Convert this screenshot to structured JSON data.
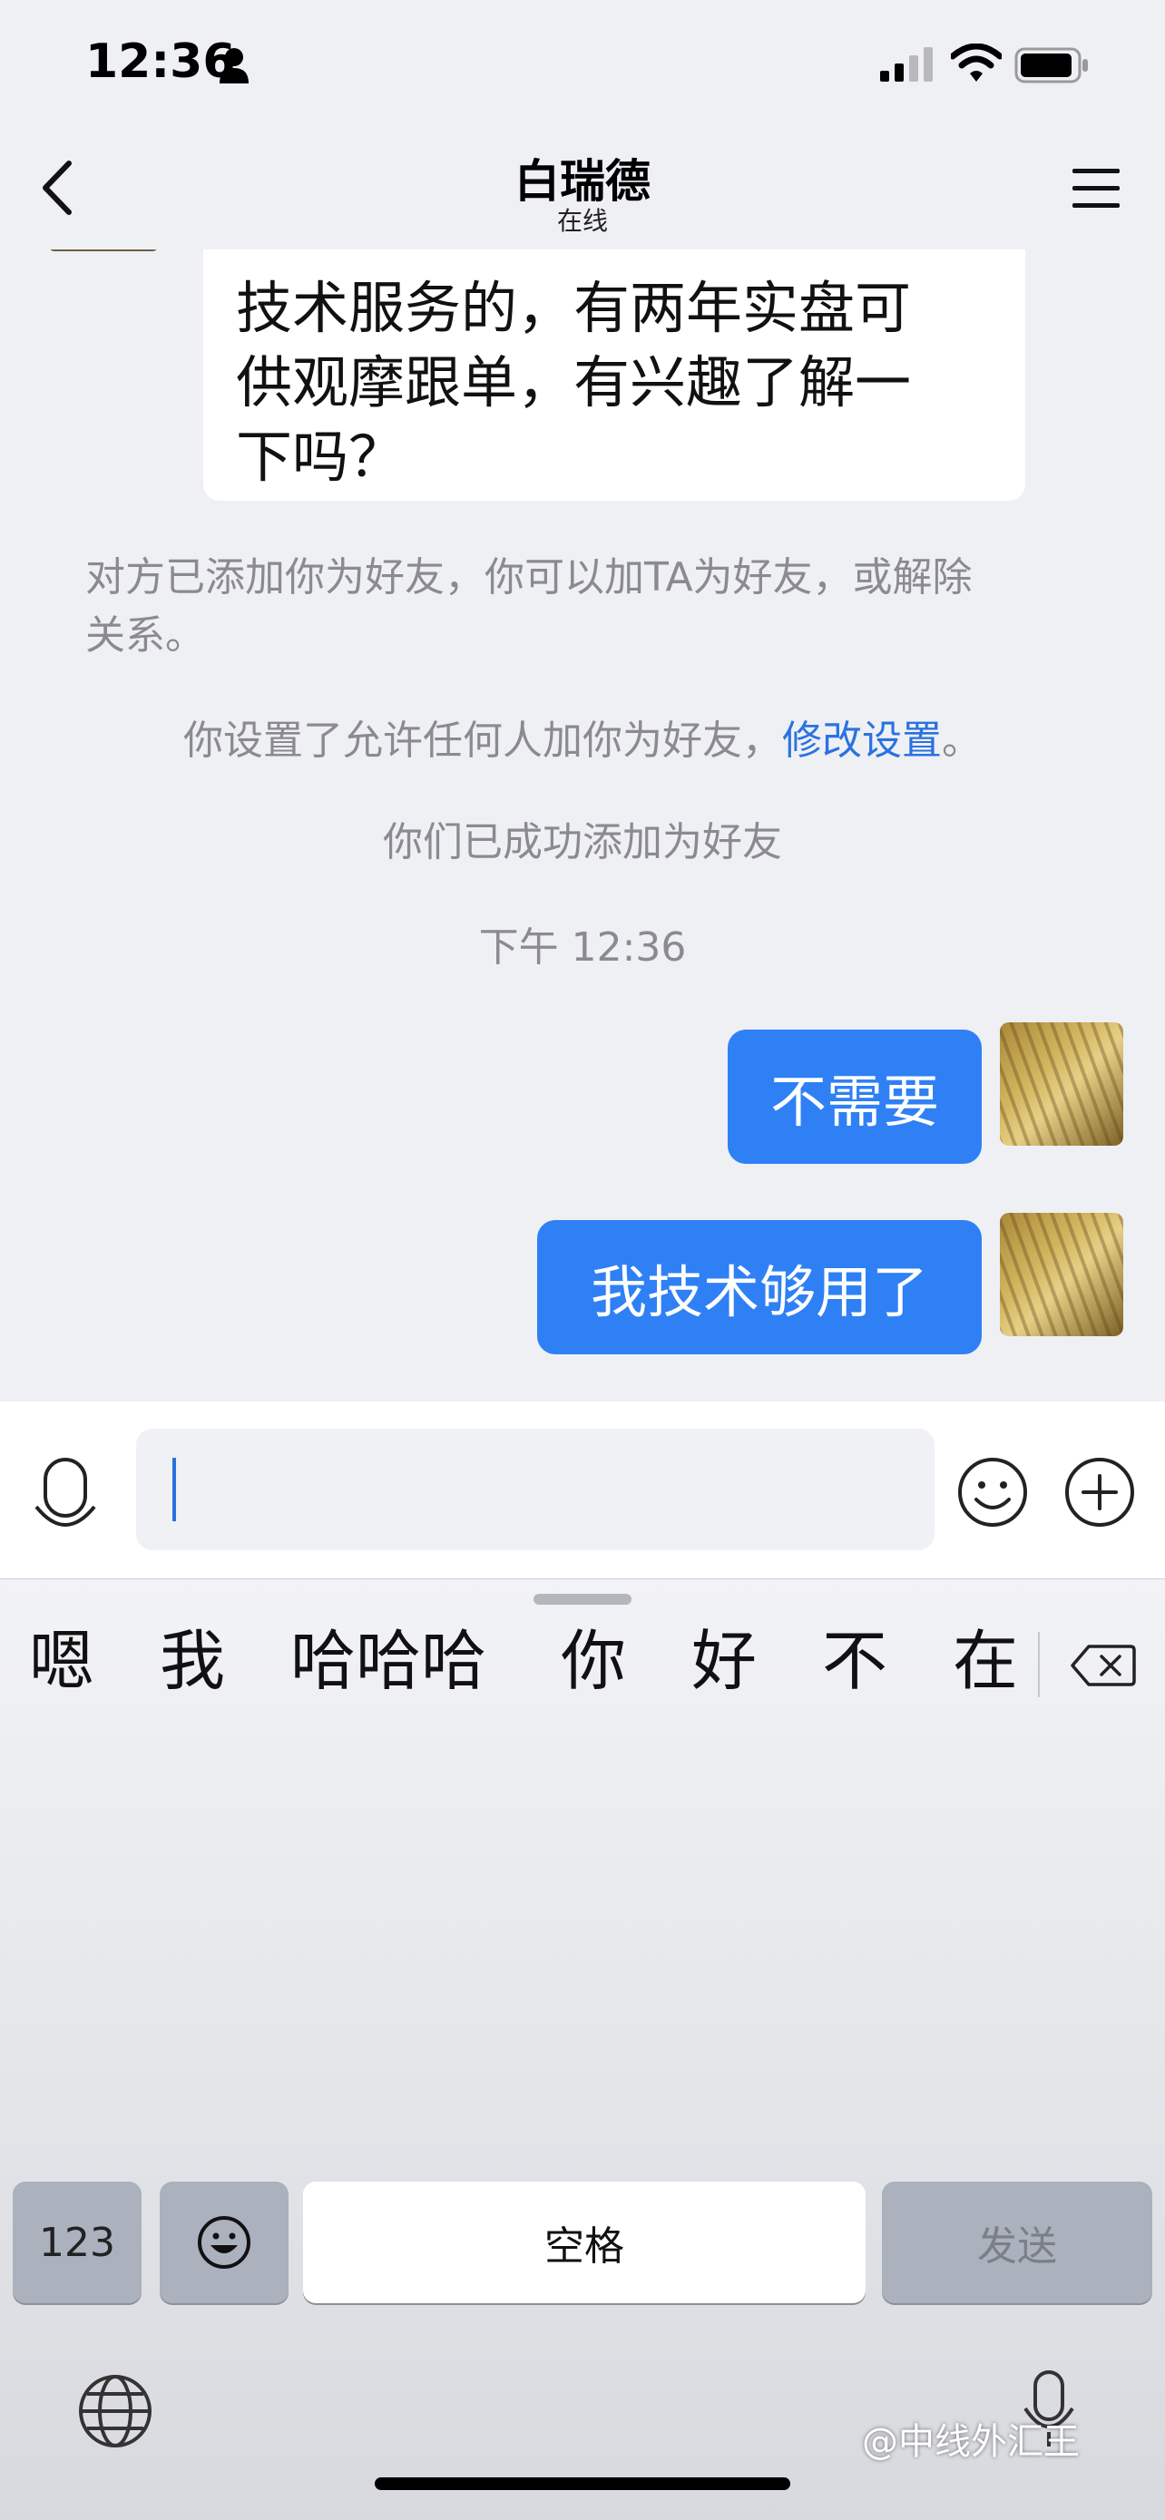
{
  "status_bar": {
    "time": "12:36"
  },
  "nav": {
    "title": "白瑞德",
    "subtitle": "在线"
  },
  "chat": {
    "incoming_message": {
      "lines": [
        "技术服务的，有两年实盘可",
        "供观摩跟单，有兴趣了解一",
        "下吗？"
      ]
    },
    "system_notice_1": {
      "line1": "对方已添加你为好友，你可以加TA为好友，或解除",
      "line2": "关系。"
    },
    "system_notice_2": {
      "text": "你设置了允许任何人加你为好友，",
      "link": "修改设置",
      "suffix": "。"
    },
    "system_notice_3": "你们已成功添加为好友",
    "timestamp": "下午 12:36",
    "outgoing_messages": [
      {
        "text": "不需要"
      },
      {
        "text": "我技术够用了"
      }
    ]
  },
  "input": {
    "value": ""
  },
  "keyboard": {
    "candidates": [
      "嗯",
      "我",
      "哈哈哈",
      "你",
      "好",
      "不",
      "在"
    ],
    "keys": {
      "numbers": "123",
      "space": "空格",
      "send": "发送"
    },
    "watermark": "@中线外汇王"
  },
  "colors": {
    "accent": "#2f80f5",
    "link": "#2a72e0",
    "background": "#eff0f4"
  }
}
